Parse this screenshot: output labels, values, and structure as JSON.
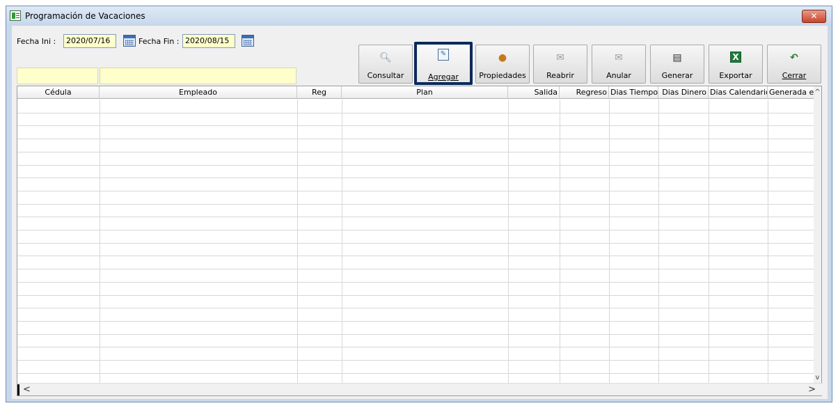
{
  "window": {
    "title": "Programación de Vacaciones",
    "close_glyph": "✕"
  },
  "filters": {
    "fecha_ini_label": "Fecha Ini :",
    "fecha_ini_value": "2020/07/16",
    "fecha_fin_label": "Fecha Fin :",
    "fecha_fin_value": "2020/08/15",
    "cedula_filter": "",
    "empleado_filter": ""
  },
  "toolbar": {
    "consultar": "Consultar",
    "agregar": "Agregar",
    "propiedades": "Propiedades",
    "reabrir": "Reabrir",
    "anular": "Anular",
    "generar": "Generar",
    "exportar": "Exportar",
    "cerrar": "Cerrar"
  },
  "grid": {
    "columns": [
      "Cédula",
      "Empleado",
      "Reg",
      "Plan",
      "Salida",
      "Regreso",
      "Dias Tiempo",
      "Dias Dinero",
      "Dias Calendario",
      "Generada en"
    ],
    "rows": []
  },
  "scroll": {
    "up": "^",
    "down": "v",
    "left": "<",
    "right": ">"
  }
}
